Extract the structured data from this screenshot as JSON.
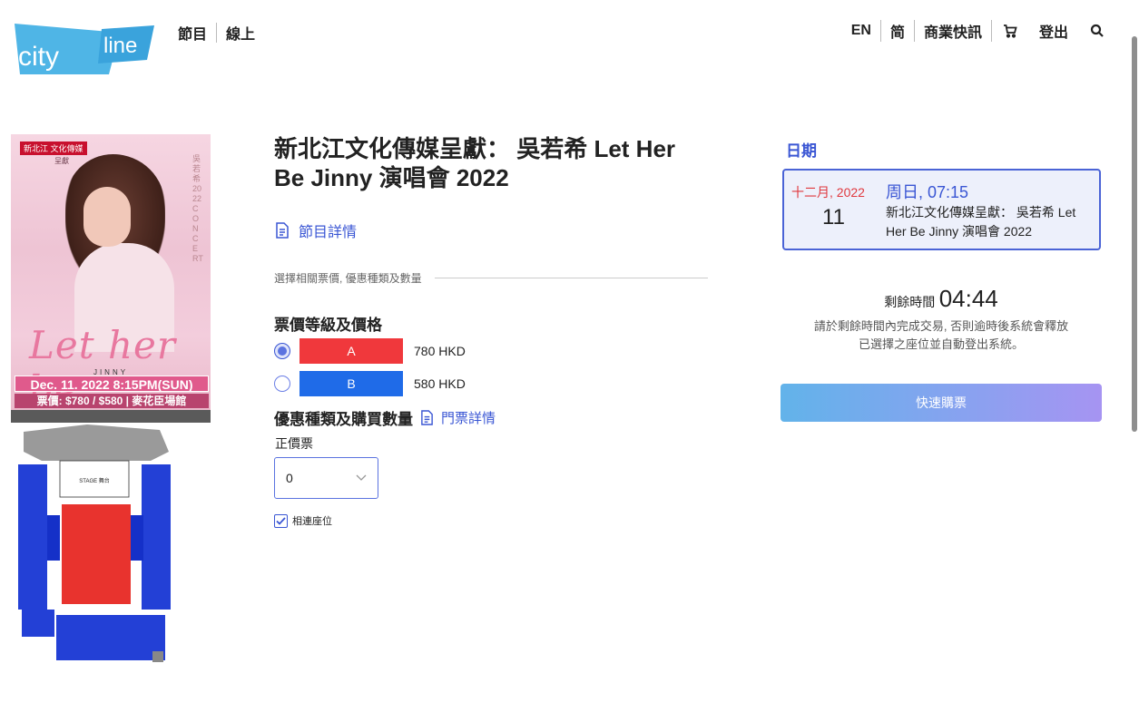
{
  "header": {
    "logo_text": "citylinE",
    "nav_left": [
      "節目",
      "線上"
    ],
    "nav_right": {
      "lang_en": "EN",
      "lang_sc": "简",
      "news": "商業快訊",
      "logout": "登出"
    }
  },
  "event": {
    "title": "新北江文化傳媒呈獻： 吳若希 Let Her Be Jinny 演唱會 2022",
    "detail_link": "節目詳情",
    "section_label": "選擇相關票價, 優惠種類及數量",
    "price_heading": "票價等級及價格",
    "tiers": [
      {
        "label": "A",
        "price": "780 HKD",
        "color": "#f0383c",
        "selected": true
      },
      {
        "label": "B",
        "price": "580 HKD",
        "color": "#1f6be8",
        "selected": false
      }
    ],
    "qty_heading": "優惠種類及購買數量",
    "ticket_detail_link": "門票詳情",
    "ticket_type": "正價票",
    "qty_value": "0",
    "adjacent_seats_label": "相連座位",
    "adjacent_seats_checked": true
  },
  "poster": {
    "brand": "新北江 文化傳媒",
    "presents": "呈獻",
    "vertical_text": "吳若希 2022 CONCERT",
    "script_title": "Let her be",
    "artist": "JINNY",
    "date_line": "Dec. 11. 2022 8:15PM(SUN)",
    "price_line": "票價: $780 / $580 | 麥花臣場館"
  },
  "seatmap": {
    "stage_label": "STAGE 舞台"
  },
  "sidebar": {
    "date_heading": "日期",
    "date_card": {
      "month": "十二月, 2022",
      "day": "11",
      "weekday_time": "周日, 07:15",
      "title": "新北江文化傳媒呈獻： 吳若希 Let Her Be Jinny 演唱會 2022"
    },
    "timer_label": "剩餘時間",
    "timer_value": "04:44",
    "timer_note_1": "請於剩餘時間內完成交易, 否則逾時後系統會釋放",
    "timer_note_2": "已選擇之座位並自動登出系統。",
    "quick_buy": "快速購票"
  },
  "colors": {
    "accent": "#3a56d4",
    "tier_a": "#f0383c",
    "tier_b": "#1f6be8",
    "month_red": "#e0383e"
  }
}
